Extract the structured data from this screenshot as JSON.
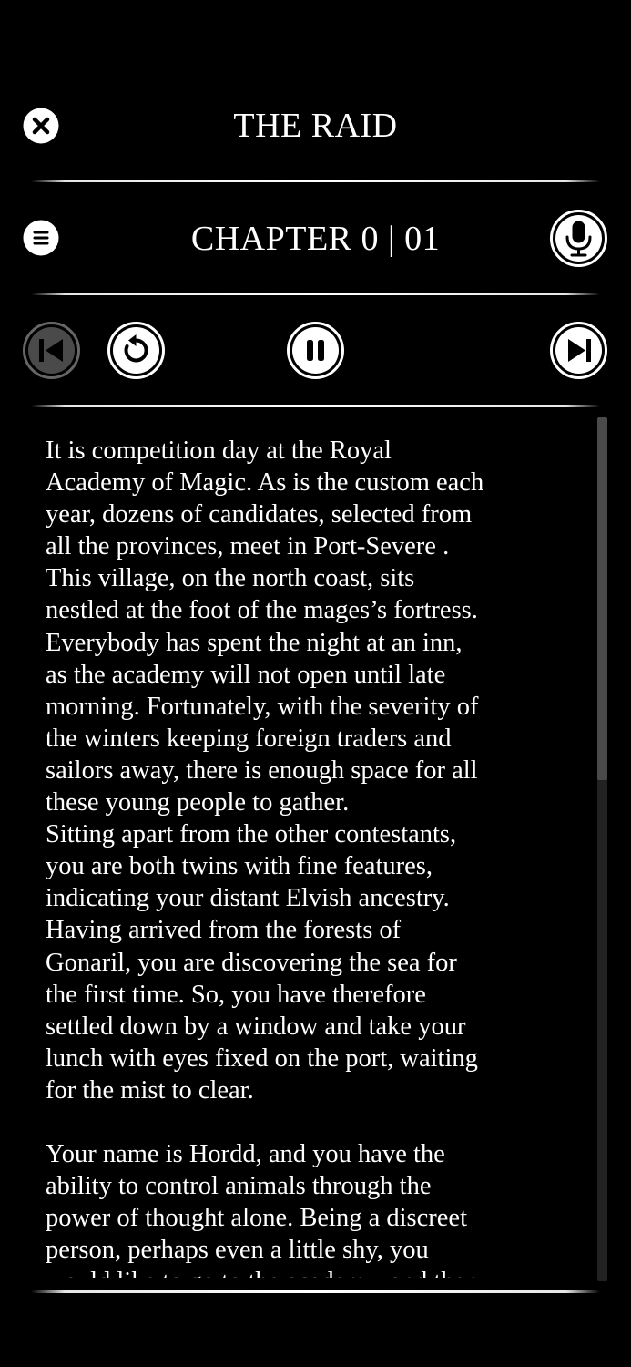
{
  "header": {
    "title": "THE RAID",
    "close_icon": "close-icon"
  },
  "chapter_bar": {
    "label": "CHAPTER 0 | 01",
    "menu_icon": "menu-icon",
    "mic_icon": "microphone-icon"
  },
  "controls": {
    "previous_icon": "skip-previous-icon",
    "previous_enabled": false,
    "replay_icon": "replay-icon",
    "pause_icon": "pause-icon",
    "next_icon": "skip-next-icon"
  },
  "story": {
    "text": "It is competition day at the Royal\nAcademy of Magic. As is the custom each\nyear, dozens of candidates, selected from\nall the provinces, meet in Port-Severe .\nThis village, on the north coast, sits\nnestled at the foot of the mages’s fortress.\nEverybody has spent the night at an inn,\nas the academy will not open until late\nmorning. Fortunately, with the severity of\nthe winters keeping foreign traders and\nsailors away, there is enough space for all\nthese young people to gather.\nSitting apart from the other contestants,\nyou are both twins with fine features,\nindicating your distant Elvish ancestry.\nHaving arrived from the forests of\nGonaril, you are discovering the sea for\nthe first time. So, you have therefore\nsettled down by a window and take your\nlunch with eyes fixed on the port, waiting\nfor the mist to clear.\n\nYour name is Hordd, and you have the\nability to control animals through the\npower of thought alone. Being a discreet\nperson, perhaps even a little shy, you\nwould like to go to the academy, and then"
  },
  "scrollbar": {
    "position_fraction": 0,
    "visible_fraction": 0.42
  }
}
